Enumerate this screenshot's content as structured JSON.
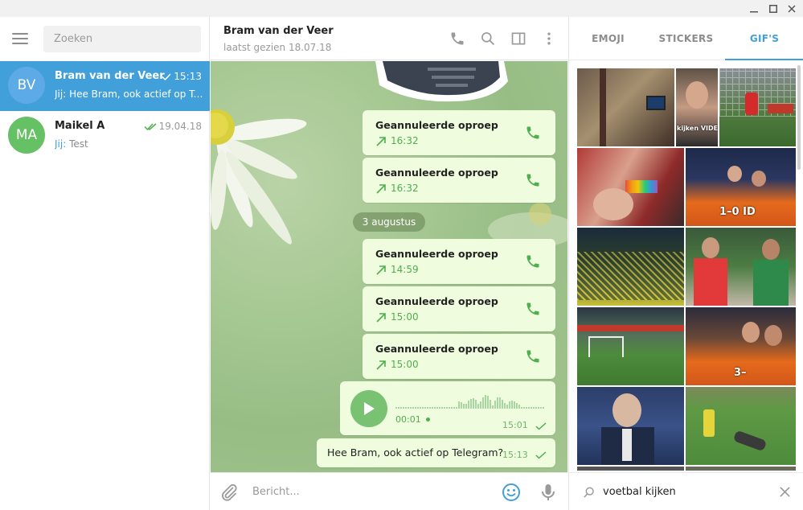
{
  "window": {
    "minimize": "minimize",
    "maximize": "maximize",
    "close": "close"
  },
  "sidebar": {
    "search_placeholder": "Zoeken",
    "chats": [
      {
        "initials": "BV",
        "name": "Bram van der Veer",
        "time": "15:13",
        "prefix": "Jij:",
        "preview": "Hee Bram, ook actief op Te...",
        "avatar_color": "#5caae6"
      },
      {
        "initials": "MA",
        "name": "Maikel A",
        "time": "19.04.18",
        "prefix": "Jij:",
        "preview": "Test",
        "avatar_color": "#66c164"
      }
    ]
  },
  "header": {
    "title": "Bram van der Veer",
    "status": "laatst gezien 18.07.18"
  },
  "messages": {
    "calls": [
      {
        "title": "Geannuleerde oproep",
        "time": "16:32"
      },
      {
        "title": "Geannuleerde oproep",
        "time": "16:32"
      },
      {
        "title": "Geannuleerde oproep",
        "time": "14:59"
      },
      {
        "title": "Geannuleerde oproep",
        "time": "15:00"
      },
      {
        "title": "Geannuleerde oproep",
        "time": "15:00"
      }
    ],
    "date_separator": "3 augustus",
    "voice": {
      "duration": "00:01",
      "time": "15:01"
    },
    "text": {
      "body": "Hee Bram, ook actief op Telegram?",
      "time": "15:13"
    }
  },
  "composer": {
    "placeholder": "Bericht..."
  },
  "panel": {
    "tabs": [
      "EMOJI",
      "STICKERS",
      "GIF'S"
    ],
    "active_tab": "GIF'S",
    "gif_captions": [
      "kijken VIDEO ook",
      "1–0 ID",
      "3–"
    ],
    "search_value": "voetbal kijken"
  },
  "colors": {
    "accent": "#419fd9",
    "bubble": "#effdde",
    "green": "#4fae4e"
  }
}
